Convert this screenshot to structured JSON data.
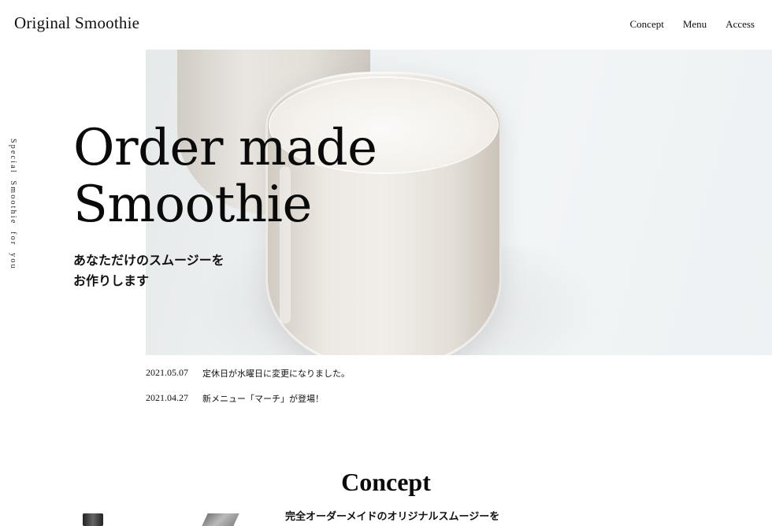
{
  "header": {
    "logo": "Original Smoothie",
    "nav": [
      {
        "label": "Concept"
      },
      {
        "label": "Menu"
      },
      {
        "label": "Access"
      }
    ]
  },
  "side_text": "Special Smoothie for you",
  "hero": {
    "headline_line1": "Order made",
    "headline_line2": "Smoothie",
    "subhead_line1": "あなただけのスムージーを",
    "subhead_line2": "お作りします"
  },
  "news": [
    {
      "date": "2021.05.07",
      "title": "定休日が水曜日に変更になりました。"
    },
    {
      "date": "2021.04.27",
      "title": "新メニュー「マーチ」が登場！"
    }
  ],
  "concept": {
    "title": "Concept",
    "lead": "完全オーダーメイドのオリジナルスムージーを"
  }
}
